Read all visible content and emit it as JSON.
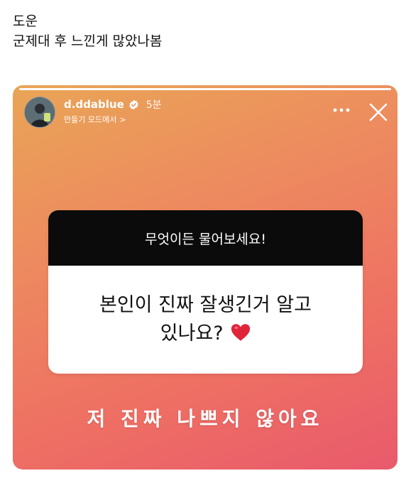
{
  "post": {
    "line1": "도운",
    "line2": "군제대 후 느낀게 많았나봄"
  },
  "story": {
    "username": "d.ddablue",
    "time": "5분",
    "subtitle": "만들기 모드에서",
    "subtitle_chevron": ">",
    "progress": 1.0,
    "icons": {
      "avatar": "avatar",
      "verified": "verified-badge-icon",
      "more": "more-options-icon",
      "close": "close-icon"
    },
    "question_header": "무엇이든 물어보세요!",
    "question_line1": "본인이 진짜 잘생긴거 알고",
    "question_line2": "있나요?",
    "question_emoji": "heart-emoji",
    "answer": "저 진짜 나쁘지 않아요",
    "colors": {
      "gradient_top": "#e9a556",
      "gradient_bottom": "#e95a6c",
      "heart": "#e0243a"
    }
  }
}
